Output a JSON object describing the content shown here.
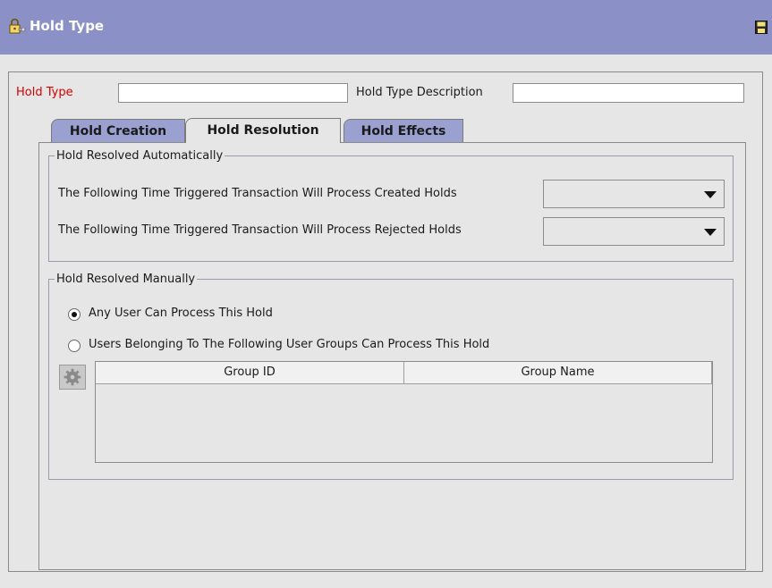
{
  "window": {
    "title": "Hold Type"
  },
  "form": {
    "hold_type_label": "Hold Type",
    "hold_type_value": "",
    "hold_type_desc_label": "Hold Type Description",
    "hold_type_desc_value": ""
  },
  "tabs": [
    {
      "label": "Hold Creation",
      "active": false
    },
    {
      "label": "Hold Resolution",
      "active": true
    },
    {
      "label": "Hold Effects",
      "active": false
    }
  ],
  "auto_group": {
    "legend": "Hold Resolved Automatically",
    "created_label": "The Following Time Triggered Transaction Will Process Created Holds",
    "created_value": "",
    "rejected_label": "The Following Time Triggered Transaction Will Process Rejected Holds",
    "rejected_value": ""
  },
  "manual_group": {
    "legend": "Hold Resolved Manually",
    "option_any": "Any User Can Process This Hold",
    "option_groups": "Users Belonging To The Following User Groups Can Process This Hold",
    "selected": "any"
  },
  "table": {
    "columns": [
      "Group ID",
      "Group Name"
    ],
    "rows": []
  },
  "colors": {
    "titlebar": "#8b90c6",
    "inactive_tab": "#9aa0cf",
    "required_label": "#d40000",
    "background": "#e6e6e6"
  },
  "icons": {
    "title": "padlock-key-icon",
    "save": "save-disk-icon",
    "lookup": "gear-icon"
  }
}
